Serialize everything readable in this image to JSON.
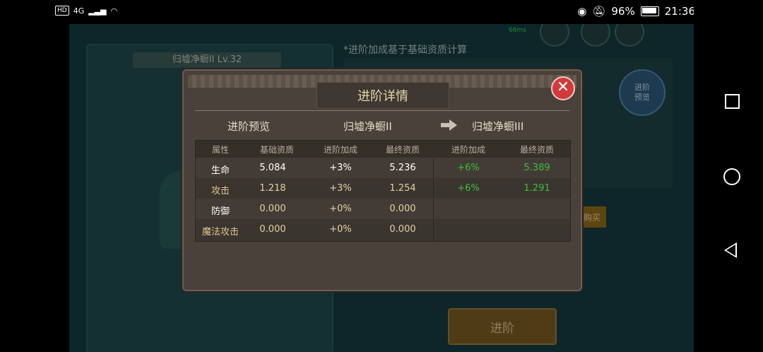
{
  "status_bar": {
    "hd": "HD",
    "net": "4G",
    "battery_pct": "96%",
    "time": "21:36"
  },
  "background": {
    "left_panel_title": "归墟净蟵II Lv.32",
    "note": "*进阶加成基于基础资质计算",
    "round_button_label": "进阶\n预览",
    "buy_label": "购买",
    "advance_label": "进阶",
    "ping": "66ms"
  },
  "modal": {
    "title": "进阶详情",
    "close_glyph": "✕",
    "preview_label": "进阶预览",
    "from_name": "归墟净蟵II",
    "to_name": "归墟净蟵III",
    "headers": [
      "属性",
      "基础资质",
      "进阶加成",
      "最终资质",
      "进阶加成",
      "最终资质"
    ],
    "rows": [
      {
        "attr": "生命",
        "base": "5.084",
        "bonus": "+3%",
        "final": "5.236",
        "next_bonus": "+6%",
        "next_final": "5.389"
      },
      {
        "attr": "攻击",
        "base": "1.218",
        "bonus": "+3%",
        "final": "1.254",
        "next_bonus": "+6%",
        "next_final": "1.291"
      },
      {
        "attr": "防御",
        "base": "0.000",
        "bonus": "+0%",
        "final": "0.000",
        "next_bonus": "",
        "next_final": ""
      },
      {
        "attr": "魔法攻击",
        "base": "0.000",
        "bonus": "+0%",
        "final": "0.000",
        "next_bonus": "",
        "next_final": ""
      }
    ]
  },
  "colors": {
    "green": "#3ebd3c",
    "gold": "#e0c58a",
    "close_red": "#d13a3a"
  }
}
